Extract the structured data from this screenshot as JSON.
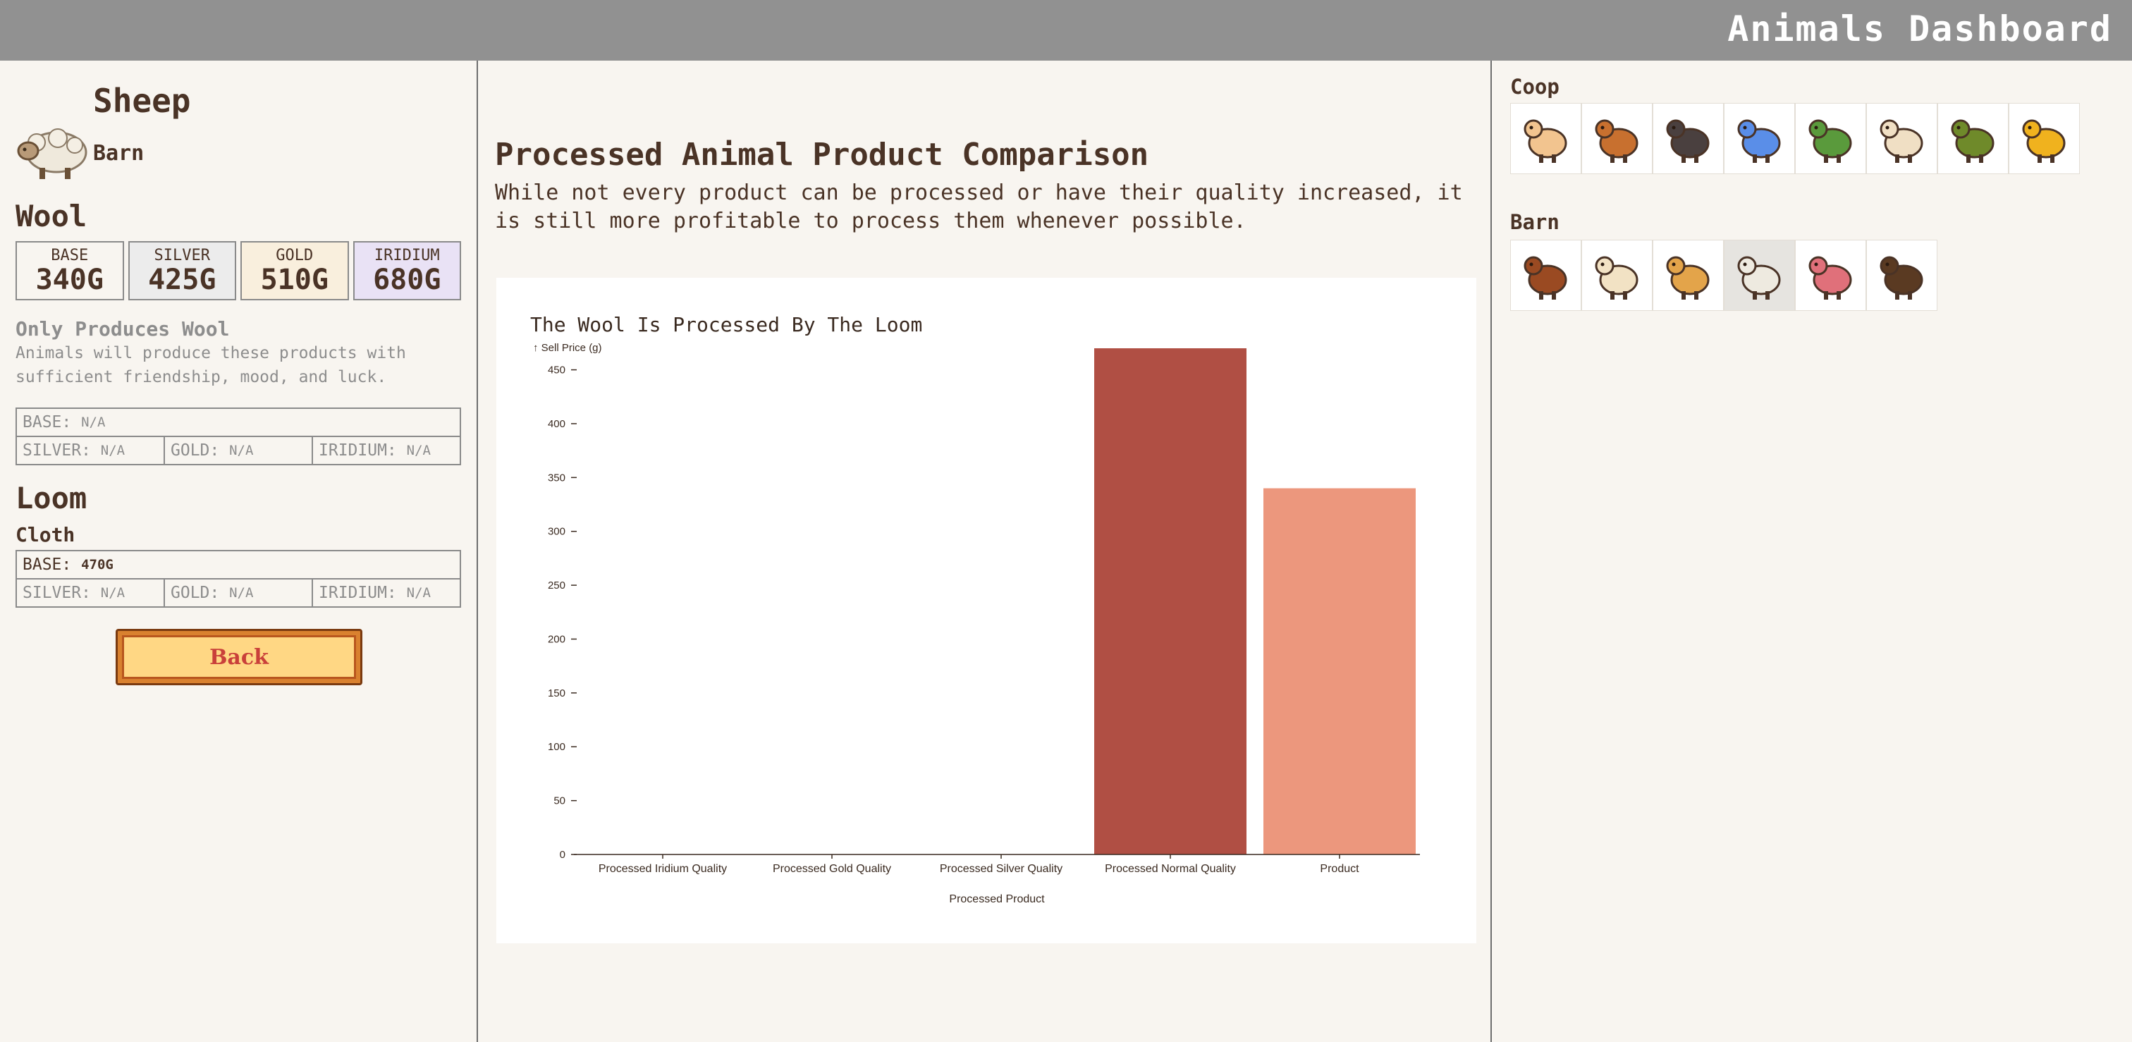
{
  "app": {
    "title": "Animals Dashboard"
  },
  "animal": {
    "name": "Sheep",
    "building": "Barn",
    "product": "Wool",
    "qualities": [
      {
        "label": "BASE",
        "value": "340G"
      },
      {
        "label": "SILVER",
        "value": "425G"
      },
      {
        "label": "GOLD",
        "value": "510G"
      },
      {
        "label": "IRIDIUM",
        "value": "680G"
      }
    ],
    "note_title": "Only Produces Wool",
    "note_text": "Animals will produce these products with sufficient friendship, mood, and luck.",
    "deluxe_prices": {
      "base_label": "BASE:",
      "base_value": "N/A",
      "silver_label": "SILVER:",
      "silver_value": "N/A",
      "gold_label": "GOLD:",
      "gold_value": "N/A",
      "iridium_label": "IRIDIUM:",
      "iridium_value": "N/A"
    },
    "machine": "Loom",
    "processed_product": "Cloth",
    "processed_prices": {
      "base_label": "BASE:",
      "base_value": "470G",
      "silver_label": "SILVER:",
      "silver_value": "N/A",
      "gold_label": "GOLD:",
      "gold_value": "N/A",
      "iridium_label": "IRIDIUM:",
      "iridium_value": "N/A"
    },
    "back_label": "Back"
  },
  "comparison": {
    "title": "Processed Animal Product Comparison",
    "description": "While not every product can be processed or have their quality increased, it is still more profitable to process them whenever possible."
  },
  "chart_data": {
    "type": "bar",
    "title": "The Wool Is Processed By The Loom",
    "ylabel": "↑ Sell Price (g)",
    "xlabel": "Processed Product",
    "categories": [
      "Processed Iridium Quality",
      "Processed Gold Quality",
      "Processed Silver Quality",
      "Processed Normal Quality",
      "Product"
    ],
    "values": [
      0,
      0,
      0,
      470,
      340
    ],
    "colors": [
      "#b04f44",
      "#b04f44",
      "#b04f44",
      "#b04f44",
      "#ec977d"
    ],
    "ylim": [
      0,
      470
    ],
    "yticks": [
      0,
      50,
      100,
      150,
      200,
      250,
      300,
      350,
      400,
      450
    ],
    "grid": false
  },
  "sidebar": {
    "coop_label": "Coop",
    "barn_label": "Barn",
    "coop_animals": [
      {
        "name": "White Chicken",
        "icon": "white-chicken-icon",
        "color": "#f2c48f"
      },
      {
        "name": "Brown Chicken",
        "icon": "brown-chicken-icon",
        "color": "#c8702f"
      },
      {
        "name": "Void Chicken",
        "icon": "void-chicken-icon",
        "color": "#4a403f"
      },
      {
        "name": "Blue Chicken",
        "icon": "blue-chicken-icon",
        "color": "#5a8ee8"
      },
      {
        "name": "Duck",
        "icon": "duck-icon",
        "color": "#5a9a3c"
      },
      {
        "name": "Rabbit",
        "icon": "rabbit-icon",
        "color": "#f0dfc4"
      },
      {
        "name": "Dinosaur",
        "icon": "dinosaur-icon",
        "color": "#6f8a2a"
      },
      {
        "name": "Golden Chicken",
        "icon": "golden-chicken-icon",
        "color": "#f0b21e"
      }
    ],
    "barn_animals": [
      {
        "name": "Brown Cow",
        "icon": "brown-cow-icon",
        "color": "#9a4a22"
      },
      {
        "name": "White Cow",
        "icon": "white-cow-icon",
        "color": "#f2e2c4"
      },
      {
        "name": "Goat",
        "icon": "goat-icon",
        "color": "#e3a44a"
      },
      {
        "name": "Sheep",
        "icon": "sheep-icon",
        "color": "#eeeae0",
        "selected": true
      },
      {
        "name": "Pig",
        "icon": "pig-icon",
        "color": "#e0707a"
      },
      {
        "name": "Ostrich",
        "icon": "ostrich-icon",
        "color": "#5a3a22"
      }
    ]
  }
}
